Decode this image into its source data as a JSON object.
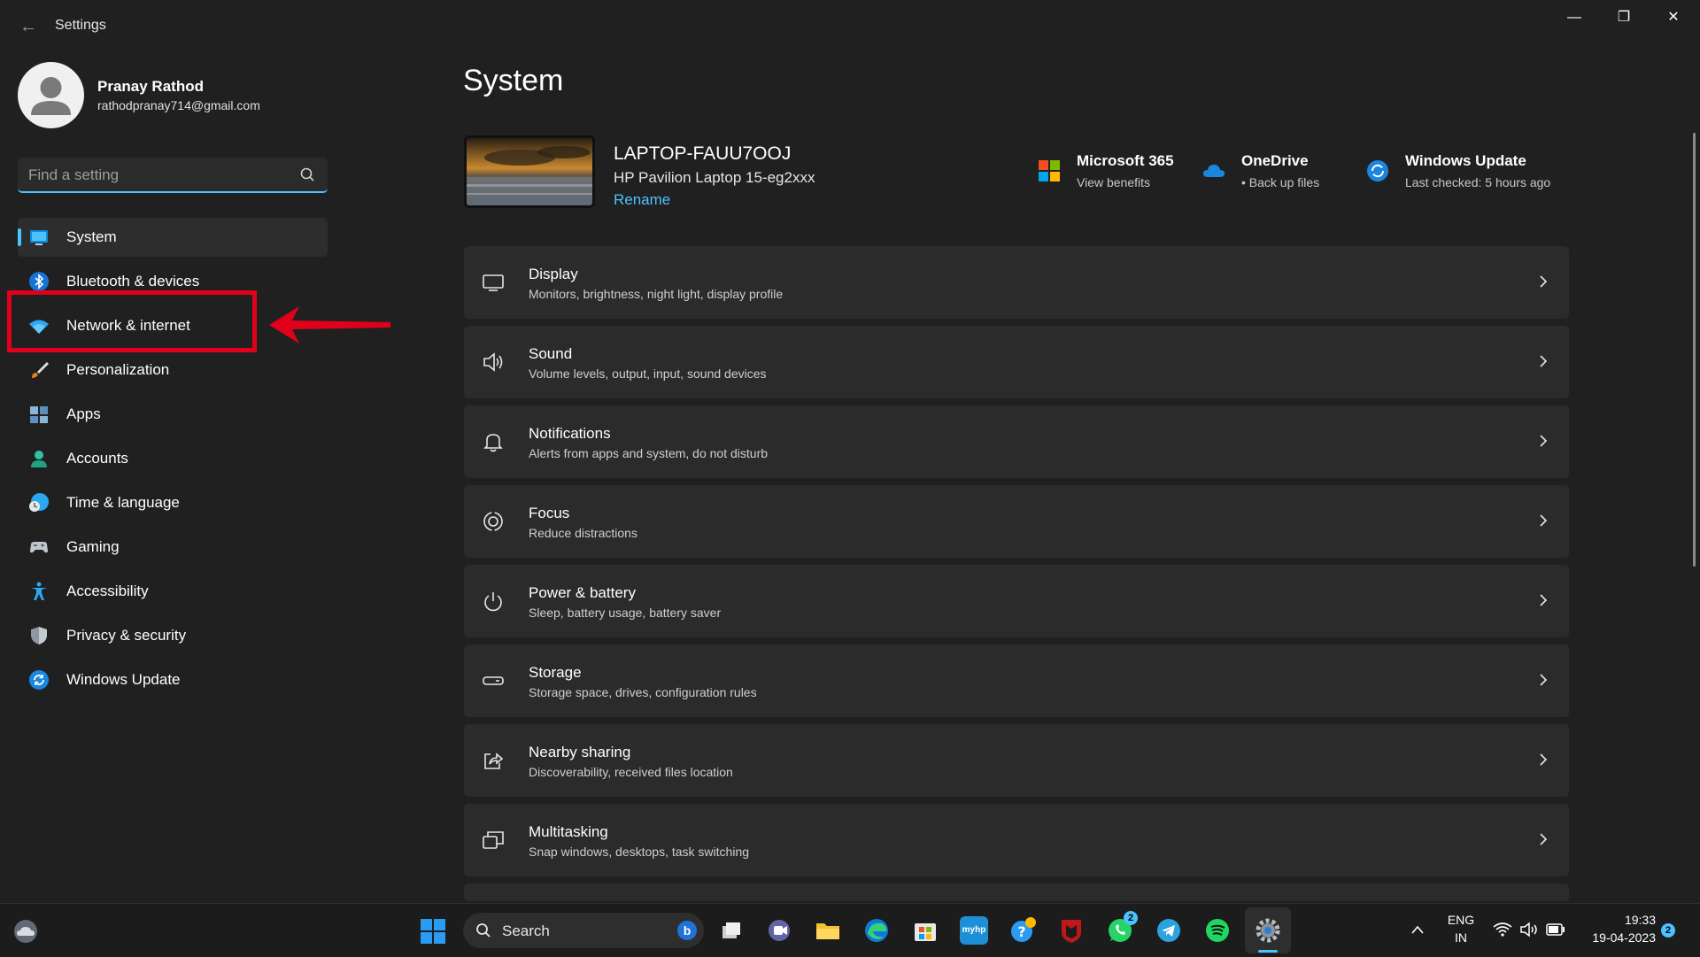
{
  "window": {
    "title": "Settings",
    "controls": {
      "minimize": "—",
      "restore": "❐",
      "close": "✕"
    }
  },
  "profile": {
    "name": "Pranay Rathod",
    "email": "rathodpranay714@gmail.com"
  },
  "search": {
    "placeholder": "Find a setting"
  },
  "sidebar": {
    "items": [
      {
        "label": "System",
        "icon": "system-icon",
        "active": true
      },
      {
        "label": "Bluetooth & devices",
        "icon": "bluetooth-icon"
      },
      {
        "label": "Network & internet",
        "icon": "wifi-icon",
        "highlighted": true
      },
      {
        "label": "Personalization",
        "icon": "brush-icon"
      },
      {
        "label": "Apps",
        "icon": "apps-icon"
      },
      {
        "label": "Accounts",
        "icon": "person-icon"
      },
      {
        "label": "Time & language",
        "icon": "clock-globe-icon"
      },
      {
        "label": "Gaming",
        "icon": "gamepad-icon"
      },
      {
        "label": "Accessibility",
        "icon": "accessibility-icon"
      },
      {
        "label": "Privacy & security",
        "icon": "shield-icon"
      },
      {
        "label": "Windows Update",
        "icon": "update-icon"
      }
    ]
  },
  "main": {
    "title": "System",
    "device": {
      "name": "LAPTOP-FAUU7OOJ",
      "model": "HP Pavilion Laptop 15-eg2xxx",
      "rename": "Rename"
    },
    "quick": [
      {
        "title": "Microsoft 365",
        "subtitle": "View benefits",
        "icon": "microsoft-logo-icon"
      },
      {
        "title": "OneDrive",
        "subtitle": "• Back up files",
        "icon": "cloud-icon"
      },
      {
        "title": "Windows Update",
        "subtitle": "Last checked: 5 hours ago",
        "icon": "update-icon"
      }
    ],
    "cards": [
      {
        "title": "Display",
        "subtitle": "Monitors, brightness, night light, display profile",
        "icon": "monitor-icon"
      },
      {
        "title": "Sound",
        "subtitle": "Volume levels, output, input, sound devices",
        "icon": "speaker-icon"
      },
      {
        "title": "Notifications",
        "subtitle": "Alerts from apps and system, do not disturb",
        "icon": "bell-icon"
      },
      {
        "title": "Focus",
        "subtitle": "Reduce distractions",
        "icon": "focus-icon"
      },
      {
        "title": "Power & battery",
        "subtitle": "Sleep, battery usage, battery saver",
        "icon": "power-icon"
      },
      {
        "title": "Storage",
        "subtitle": "Storage space, drives, configuration rules",
        "icon": "storage-icon"
      },
      {
        "title": "Nearby sharing",
        "subtitle": "Discoverability, received files location",
        "icon": "share-icon"
      },
      {
        "title": "Multitasking",
        "subtitle": "Snap windows, desktops, task switching",
        "icon": "multitask-icon"
      }
    ]
  },
  "taskbar": {
    "search_label": "Search",
    "bing_label": "b",
    "hp_label": "myhp",
    "whatsapp_badge": "2",
    "notification_badge": "2",
    "lang_top": "ENG",
    "lang_bottom": "IN",
    "time": "19:33",
    "date": "19-04-2023"
  },
  "colors": {
    "accent": "#4cc2ff",
    "highlight": "#e0001b",
    "background": "#202020",
    "card": "#2b2b2b"
  }
}
